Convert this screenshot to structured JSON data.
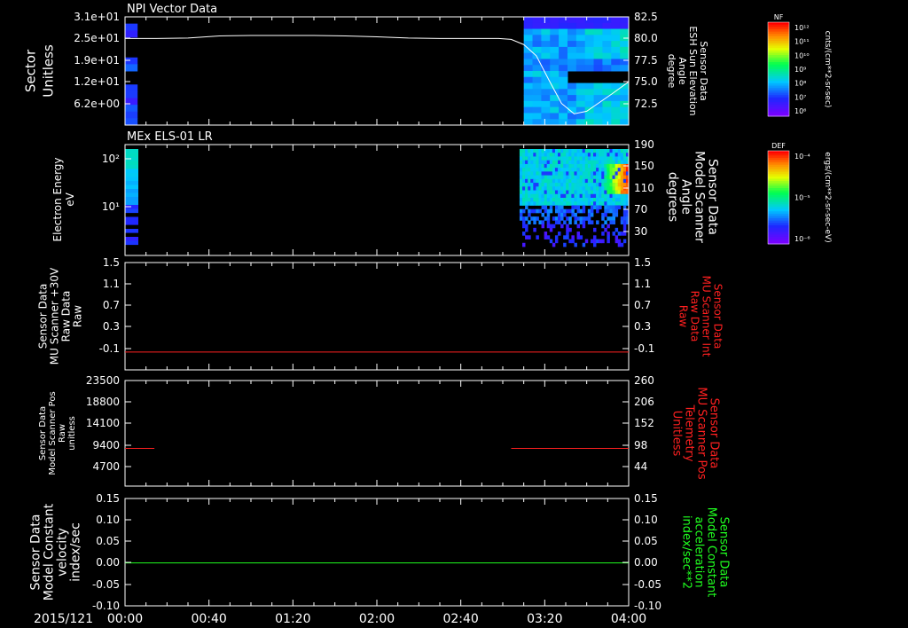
{
  "colors": {
    "axis": "#ffffff",
    "red": "#ff2020",
    "green": "#20ff20",
    "background": "#000000"
  },
  "chart_data": [
    {
      "type": "heatmap",
      "id": "panel1",
      "title": "NPI Vector Data",
      "ylabel_left": [
        "Sector",
        "Unitless"
      ],
      "ylabel_right": [
        "Sensor Data",
        "ESH Sun Elevation",
        "Angle",
        "degree"
      ],
      "yticks_left": [
        "3.1e+01",
        "2.5e+01",
        "1.9e+01",
        "1.2e+01",
        "6.2e+00"
      ],
      "yticks_right": [
        "82.5",
        "80.0",
        "77.5",
        "75.0",
        "72.5"
      ],
      "ylim_right": [
        70.0,
        82.5
      ],
      "line_series": {
        "name": "ESH Sun Elevation Angle",
        "color": "#ffffff",
        "x_min": [
          0,
          15,
          30,
          45,
          60,
          75,
          90,
          105,
          120,
          135,
          150,
          165,
          178,
          184,
          190,
          196,
          202,
          208,
          214,
          220,
          226,
          232,
          240
        ],
        "y": [
          80.0,
          80.0,
          80.05,
          80.3,
          80.35,
          80.35,
          80.35,
          80.3,
          80.2,
          80.05,
          80.0,
          80.0,
          80.0,
          79.9,
          79.3,
          78.0,
          75.2,
          72.5,
          71.3,
          71.6,
          72.6,
          73.6,
          75.0
        ]
      },
      "colorbar": {
        "label": "NF",
        "units": "cnts/(cm**2-sr-sec)",
        "ticks": [
          "10¹²",
          "10¹¹",
          "10¹⁰",
          "10⁹",
          "10⁸",
          "10⁷",
          "10⁶"
        ]
      },
      "data_segments": [
        {
          "start_min": 0,
          "end_min": 3
        },
        {
          "start_min": 190,
          "end_min": 240
        }
      ]
    },
    {
      "type": "heatmap",
      "id": "panel2",
      "title": "MEx ELS-01 LR",
      "ylabel_left": [
        "Electron Energy",
        "eV"
      ],
      "ylabel_right": [
        "Sensor Data",
        "Model Scanner",
        "Angle",
        "degrees"
      ],
      "yticks_left": [
        "10²",
        "10¹"
      ],
      "yticks_right": [
        "190",
        "150",
        "110",
        "70",
        "30"
      ],
      "ylim_right": [
        10,
        190
      ],
      "line_series": {
        "name": "Model Scanner Angle",
        "color": "#ffffff",
        "x_min": [
          0,
          240
        ],
        "y": [
          10,
          10
        ]
      },
      "colorbar": {
        "label": "DEF",
        "units": "ergs/(cm**2-sr-sec-eV)",
        "ticks": [
          "10⁻⁴",
          "10⁻⁵",
          "10⁻⁶"
        ]
      },
      "data_segments": [
        {
          "start_min": 0,
          "end_min": 6
        },
        {
          "start_min": 188,
          "end_min": 240
        }
      ]
    },
    {
      "type": "line",
      "id": "panel3",
      "ylabel_left": [
        "Sensor Data",
        "MU Scanner +30V",
        "Raw Data",
        "Raw"
      ],
      "ylabel_right": [
        "Sensor Data",
        "MU Scanner Int",
        "Raw Data",
        "Raw"
      ],
      "yticks_left": [
        "1.5",
        "1.1",
        "0.7",
        "0.3",
        "-0.1"
      ],
      "yticks_right": [
        "1.5",
        "1.1",
        "0.7",
        "0.3",
        "-0.1"
      ],
      "ylim": [
        -0.3,
        1.5
      ],
      "series": [
        {
          "name": "MU Scanner Int",
          "color": "#ff2020",
          "x_min": [
            0,
            240
          ],
          "y": [
            0.0,
            0.0
          ]
        }
      ]
    },
    {
      "type": "line",
      "id": "panel4",
      "ylabel_left": [
        "Sensor Data",
        "Model Scanner Pos",
        "Raw",
        "unitless"
      ],
      "ylabel_right": [
        "Sensor Data",
        "MU Scanner Pos",
        "Telemetry",
        "Unitless"
      ],
      "yticks_left": [
        "23500",
        "18800",
        "14100",
        "9400",
        "4700"
      ],
      "yticks_right": [
        "260",
        "206",
        "152",
        "98",
        "44"
      ],
      "ylim": [
        0,
        23500
      ],
      "series": [
        {
          "name": "MU Scanner Pos",
          "color": "#ff2020",
          "x_min": [
            0,
            14
          ],
          "y": [
            8400,
            8400
          ]
        },
        {
          "name": "MU Scanner Pos",
          "color": "#ff2020",
          "x_min": [
            184,
            240
          ],
          "y": [
            8400,
            8400
          ]
        }
      ]
    },
    {
      "type": "line",
      "id": "panel5",
      "ylabel_left": [
        "Sensor Data",
        "Model Constant",
        "velocity",
        "index/sec"
      ],
      "ylabel_right": [
        "Sensor Data",
        "Model Constant",
        "acceleration",
        "index/sec**2"
      ],
      "yticks_left": [
        "0.15",
        "0.10",
        "0.05",
        "0.00",
        "-0.05",
        "-0.10"
      ],
      "yticks_right": [
        "0.15",
        "0.10",
        "0.05",
        "0.00",
        "-0.05",
        "-0.10"
      ],
      "ylim": [
        -0.1,
        0.15
      ],
      "series": [
        {
          "name": "Model Constant acceleration",
          "color": "#20ff20",
          "x_min": [
            0,
            240
          ],
          "y": [
            0.0,
            0.0
          ]
        }
      ]
    }
  ],
  "time_axis": {
    "date_label": "2015/121",
    "ticks": [
      "00:00",
      "00:40",
      "01:20",
      "02:00",
      "02:40",
      "03:20",
      "04:00"
    ],
    "tick_minutes": [
      0,
      40,
      80,
      120,
      160,
      200,
      240
    ],
    "range_min": [
      0,
      240
    ]
  }
}
